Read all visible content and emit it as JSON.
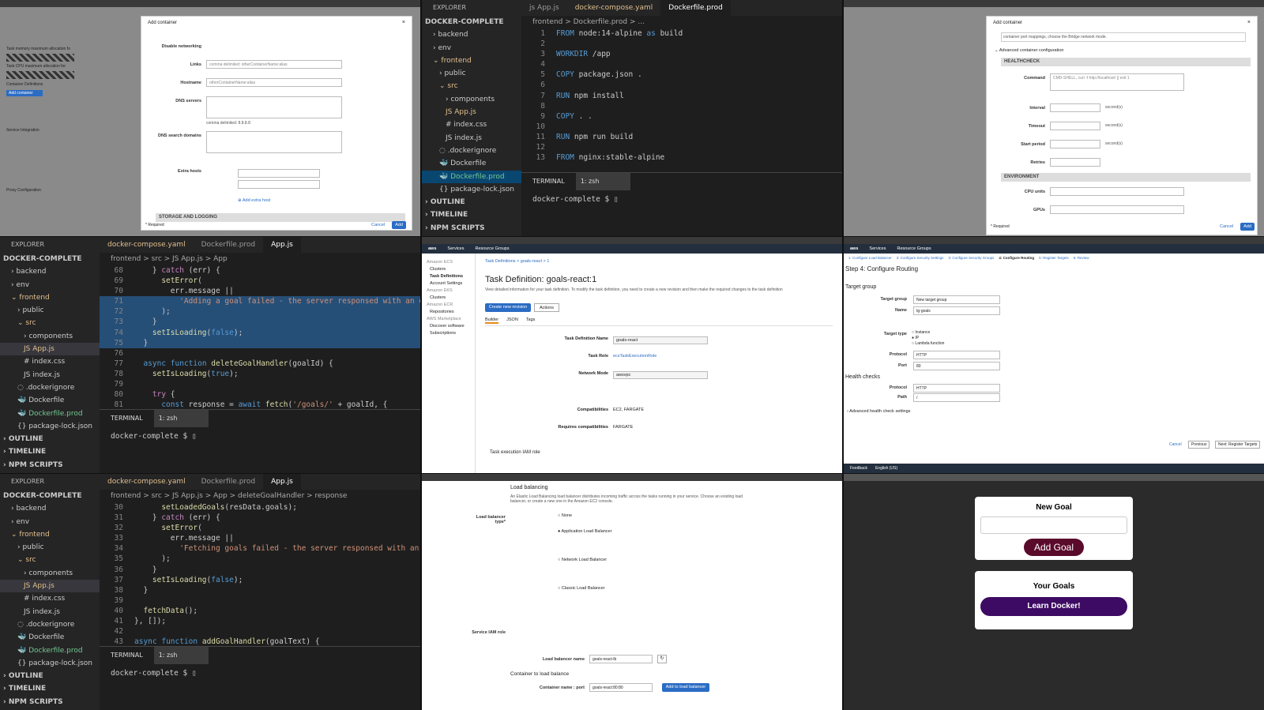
{
  "vs1": {
    "explorer": "EXPLORER",
    "project": "DOCKER-COMPLETE",
    "tree": [
      "backend",
      "env",
      "frontend",
      "public",
      "src",
      "components",
      "App.js",
      "index.css",
      "index.js",
      ".dockerignore",
      "Dockerfile",
      "Dockerfile.prod",
      "package-lock.json"
    ],
    "tabs": [
      "js App.js",
      "docker-compose.yaml",
      "Dockerfile.prod"
    ],
    "crumb": "frontend > Dockerfile.prod > ...",
    "lines": [
      [
        "1",
        "FROM node:14-alpine as build"
      ],
      [
        "2",
        ""
      ],
      [
        "3",
        "WORKDIR /app"
      ],
      [
        "4",
        ""
      ],
      [
        "5",
        "COPY package.json ."
      ],
      [
        "6",
        ""
      ],
      [
        "7",
        "RUN npm install"
      ],
      [
        "8",
        ""
      ],
      [
        "9",
        "COPY . ."
      ],
      [
        "10",
        ""
      ],
      [
        "11",
        "RUN npm run build"
      ],
      [
        "12",
        ""
      ],
      [
        "13",
        "FROM nginx:stable-alpine"
      ]
    ],
    "outline": "OUTLINE",
    "timeline": "TIMELINE",
    "npm": "NPM SCRIPTS",
    "terminal": "TERMINAL",
    "shell": "1: zsh",
    "prompt": "docker-complete $ "
  },
  "vs2": {
    "tabs": [
      "docker-compose.yaml",
      "Dockerfile.prod",
      "App.js"
    ],
    "crumb": "frontend > src > JS App.js > App",
    "lines": [
      [
        "68",
        "    } catch (err) {"
      ],
      [
        "69",
        "      setError("
      ],
      [
        "70",
        "        err.message ||"
      ],
      [
        "71",
        "          'Adding a goal failed - the server responsed with an err"
      ],
      [
        "72",
        "      );"
      ],
      [
        "73",
        "    }"
      ],
      [
        "74",
        "    setIsLoading(false);"
      ],
      [
        "75",
        "  }"
      ],
      [
        "76",
        ""
      ],
      [
        "77",
        "  async function deleteGoalHandler(goalId) {"
      ],
      [
        "78",
        "    setIsLoading(true);"
      ],
      [
        "79",
        ""
      ],
      [
        "80",
        "    try {"
      ],
      [
        "81",
        "      const response = await fetch('/goals/' + goalId, {"
      ]
    ]
  },
  "vs3": {
    "crumb": "frontend > src > JS App.js > App > deleteGoalHandler > response",
    "lines": [
      [
        "30",
        "      setLoadedGoals(resData.goals);"
      ],
      [
        "31",
        "    } catch (err) {"
      ],
      [
        "32",
        "      setError("
      ],
      [
        "33",
        "        err.message ||"
      ],
      [
        "34",
        "          'Fetching goals failed - the server responsed with an e"
      ],
      [
        "35",
        "      );"
      ],
      [
        "36",
        "    }"
      ],
      [
        "37",
        "    setIsLoading(false);"
      ],
      [
        "38",
        "  }"
      ],
      [
        "39",
        ""
      ],
      [
        "40",
        "  fetchData();"
      ],
      [
        "41",
        "}, []);"
      ],
      [
        "42",
        ""
      ],
      [
        "43",
        "async function addGoalHandler(goalText) {"
      ]
    ]
  },
  "aws_container": {
    "title": "Add container",
    "fields": [
      "Disable networking",
      "Links",
      "Hostname",
      "DNS servers",
      "DNS search domains",
      "Extra hosts"
    ],
    "placeholders": [
      "comma delimited: otherContainerName:alias",
      "otherContainerName:alias",
      "comma delimited: 8.8.8.8"
    ],
    "add_host": "Add extra host",
    "section": "STORAGE AND LOGGING",
    "required": "* Required",
    "cancel": "Cancel",
    "add": "Add",
    "bg_left": [
      "Task memory maximum allocation fo",
      "Task CPU maximum allocation for",
      "Container Definitions",
      "Add container",
      "Service Integration",
      "Proxy Configuration"
    ]
  },
  "aws_health": {
    "title": "Add container",
    "note": "container port mappings, choose the Bridge network mode.",
    "advanced": "Advanced container configuration",
    "section1": "HEALTHCHECK",
    "fields1": [
      "Command",
      "Interval",
      "Timeout",
      "Start period",
      "Retries"
    ],
    "cmd_placeholder": "CMD-SHELL, curl -f http://localhost/ || exit 1",
    "unit": "second(s)",
    "section2": "ENVIRONMENT",
    "fields2": [
      "CPU units",
      "GPUs"
    ],
    "required": "* Required",
    "cancel": "Cancel",
    "add": "Add"
  },
  "aws_task": {
    "nav": [
      "Services",
      "Resource Groups"
    ],
    "sidebar": [
      "Amazon ECS",
      "Clusters",
      "Task Definitions",
      "Account Settings",
      "Amazon EKS",
      "Clusters",
      "Amazon ECR",
      "Repositories",
      "AWS Marketplace",
      "Discover software",
      "Subscriptions"
    ],
    "crumb": "Task Definitions > goals-react > 1",
    "title": "Task Definition: goals-react:1",
    "desc": "View detailed information for your task definition. To modify the task definition, you need to create a new revision and then make the required changes to the task definition",
    "create": "Create new revision",
    "actions": "Actions",
    "tabs": [
      "Builder",
      "JSON",
      "Tags"
    ],
    "rows": [
      [
        "Task Definition Name",
        "goals-react"
      ],
      [
        "Task Role",
        "ecsTaskExecutionRole"
      ],
      [
        "Network Mode",
        "awsvpc"
      ],
      [
        "Compatibilities",
        "EC2, FARGATE"
      ],
      [
        "Requires compatibilities",
        "FARGATE"
      ]
    ],
    "iam": "Task execution IAM role"
  },
  "aws_routing": {
    "steps": [
      "1: Configure Load Balancer",
      "2: Configure Security Settings",
      "3: Configure Security Groups",
      "4: Configure Routing",
      "5: Register Targets",
      "6: Review"
    ],
    "title": "Step 4: Configure Routing",
    "target_group": "Target group",
    "rows": [
      [
        "Target group",
        "New target group"
      ],
      [
        "Name",
        "tg-goals"
      ],
      [
        "Protocol",
        "HTTP"
      ],
      [
        "Port",
        "80"
      ]
    ],
    "target_type": "Target type",
    "types": [
      "Instance",
      "IP",
      "Lambda function"
    ],
    "health": "Health checks",
    "hrows": [
      [
        "Protocol",
        "HTTP"
      ],
      [
        "Path",
        "/"
      ]
    ],
    "advanced": "Advanced health check settings",
    "cancel": "Cancel",
    "previous": "Previous",
    "next": "Next: Register Targets",
    "footer": [
      "Feedback",
      "English (US)"
    ]
  },
  "aws_lb": {
    "title": "Load balancing",
    "desc": "An Elastic Load Balancing load balancer distributes incoming traffic across the tasks running in your service. Choose an existing load balancer, or create a new one in the Amazon EC2 console.",
    "type_label": "Load balancer type*",
    "options": [
      "None",
      "Application Load Balancer",
      "Network Load Balancer",
      "Classic Load Balancer"
    ],
    "iam_label": "Service IAM role",
    "name_label": "Load balancer name",
    "name_value": "goals-react-lb",
    "container_title": "Container to load balance",
    "container_label": "Container name : port",
    "container_value": "goals-react:80:80",
    "add_btn": "Add to load balancer"
  },
  "app": {
    "new_goal": "New Goal",
    "add_goal": "Add Goal",
    "your_goals": "Your Goals",
    "goal": "Learn Docker!"
  }
}
